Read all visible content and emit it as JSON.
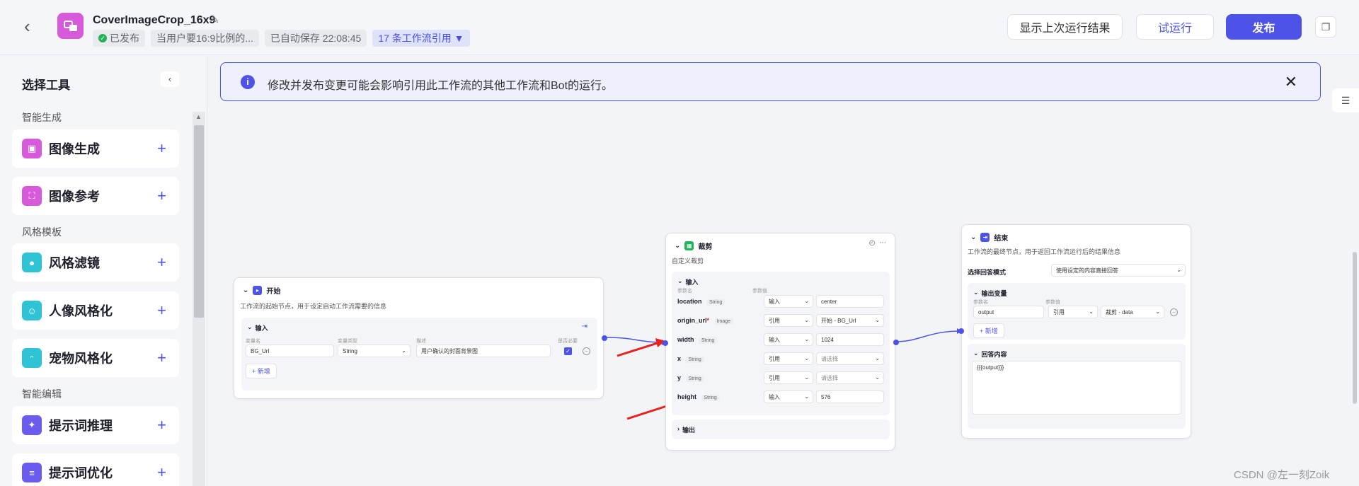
{
  "header": {
    "title": "CoverImageCrop_16x9",
    "status": "已发布",
    "description": "当用户要16:9比例的...",
    "autosave": "已自动保存 22:08:45",
    "references": "17 条工作流引用 ▼",
    "btn_last_result": "显示上次运行结果",
    "btn_test_run": "试运行",
    "btn_publish": "发布"
  },
  "sidebar": {
    "title": "选择工具",
    "cat1": "智能生成",
    "cat2": "风格模板",
    "cat3": "智能编辑",
    "items": [
      {
        "label": "图像生成",
        "color": "#d65ad9"
      },
      {
        "label": "图像参考",
        "color": "#d65ad9"
      },
      {
        "label": "风格滤镜",
        "color": "#2ec4d6"
      },
      {
        "label": "人像风格化",
        "color": "#2ec4d6"
      },
      {
        "label": "宠物风格化",
        "color": "#2ec4d6"
      },
      {
        "label": "提示词推理",
        "color": "#6b5cf0"
      },
      {
        "label": "提示词优化",
        "color": "#6b5cf0"
      }
    ]
  },
  "notice": {
    "text": "修改并发布变更可能会影响引用此工作流的其他工作流和Bot的运行。"
  },
  "start_node": {
    "title": "开始",
    "desc": "工作流的起始节点，用于设定启动工作流需要的信息",
    "input_label": "输入",
    "col_name": "变量名",
    "col_type": "变量类型",
    "col_desc": "描述",
    "col_required": "是否必要",
    "var_name": "BG_Url",
    "var_type": "String",
    "var_desc": "用户确认的封面背景图",
    "add_label": "+ 新增"
  },
  "crop_node": {
    "title": "裁剪",
    "desc": "自定义裁剪",
    "input_label": "输入",
    "col_name": "参数名",
    "col_value": "参数值",
    "params": [
      {
        "name": "location",
        "type": "String",
        "mode": "输入",
        "value": "center"
      },
      {
        "name": "origin_url",
        "required": "*",
        "type": "Image",
        "mode": "引用",
        "value": "开始 - BG_Url"
      },
      {
        "name": "width",
        "type": "String",
        "mode": "输入",
        "value": "1024"
      },
      {
        "name": "x",
        "type": "String",
        "mode": "引用",
        "value": "请选择"
      },
      {
        "name": "y",
        "type": "String",
        "mode": "引用",
        "value": "请选择"
      },
      {
        "name": "height",
        "type": "String",
        "mode": "输入",
        "value": "576"
      }
    ],
    "output_label": "输出"
  },
  "end_node": {
    "title": "结束",
    "desc": "工作流的最终节点，用于返回工作流运行后的结果信息",
    "answer_mode_label": "选择回答模式",
    "answer_mode_value": "使用设定的内容直接回答",
    "output_vars_label": "输出变量",
    "col_name": "参数名",
    "col_value": "参数值",
    "var_name": "output",
    "var_mode": "引用",
    "var_value": "裁剪 - data",
    "add_label": "+ 新增",
    "answer_content_label": "回答内容",
    "answer_content": "{{{output}}}"
  },
  "watermark": "CSDN @左一刻Zoik"
}
